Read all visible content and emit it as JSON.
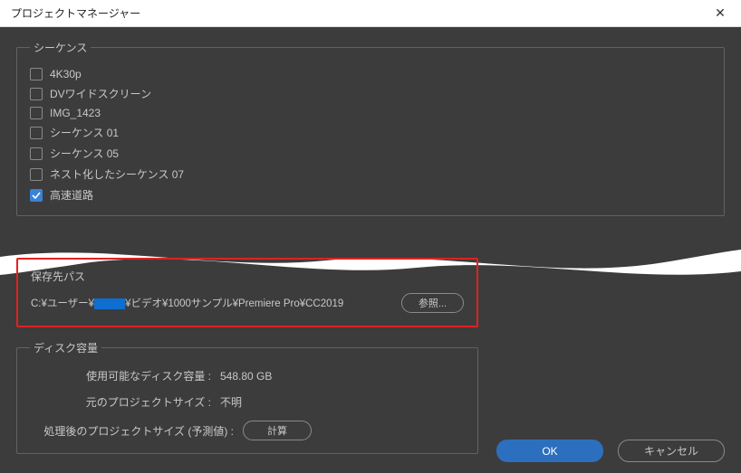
{
  "window": {
    "title": "プロジェクトマネージャー"
  },
  "sequences": {
    "legend": "シーケンス",
    "items": [
      {
        "label": "4K30p",
        "checked": false
      },
      {
        "label": "DVワイドスクリーン",
        "checked": false
      },
      {
        "label": "IMG_1423",
        "checked": false
      },
      {
        "label": "シーケンス 01",
        "checked": false
      },
      {
        "label": "シーケンス 05",
        "checked": false
      },
      {
        "label": "ネスト化したシーケンス 07",
        "checked": false
      },
      {
        "label": "高速道路",
        "checked": true
      }
    ]
  },
  "destination": {
    "legend": "保存先パス",
    "path_prefix": "C:¥ユーザー¥",
    "path_suffix": "¥ビデオ¥1000サンプル¥Premiere Pro¥CC2019",
    "browse": "参照..."
  },
  "disk": {
    "legend": "ディスク容量",
    "available_label": "使用可能なディスク容量 :",
    "available_value": "548.80 GB",
    "original_label": "元のプロジェクトサイズ :",
    "original_value": "不明",
    "processed_label": "処理後のプロジェクトサイズ (予測値) :",
    "calc_button": "計算"
  },
  "footer": {
    "ok": "OK",
    "cancel": "キャンセル"
  }
}
